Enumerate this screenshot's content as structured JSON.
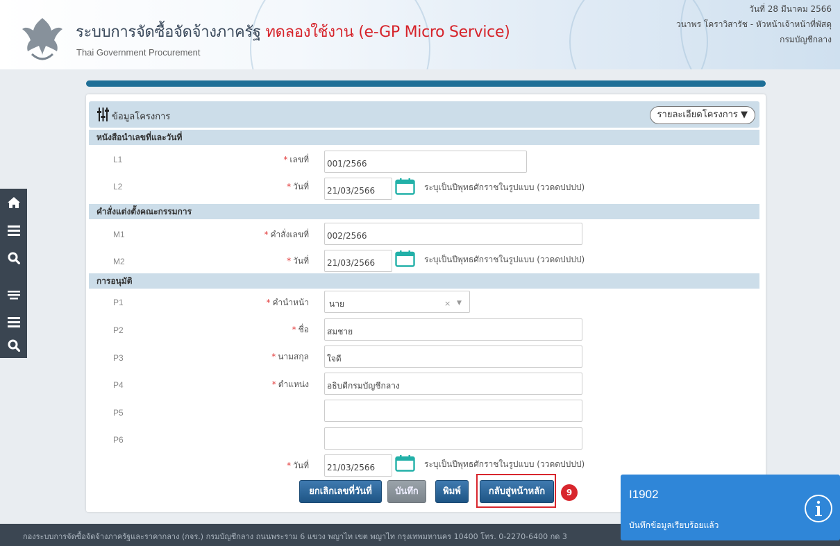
{
  "header": {
    "title_main": "ระบบการจัดซื้อจัดจ้างภาครัฐ",
    "title_trial": "ทดลองใช้งาน (e-GP Micro Service)",
    "subtitle": "Thai Government Procurement",
    "date": "วันที่ 28 มีนาคม 2566",
    "user": "วนาพร โคราวิสารัช - หัวหน้าเจ้าหน้าที่พัสดุ",
    "department": "กรมบัญชีกลาง"
  },
  "sidebar": {
    "icons": [
      "home-icon",
      "menu-icon",
      "search-icon",
      "list-icon",
      "menu-icon",
      "search-icon"
    ]
  },
  "project": {
    "title": "ข้อมูลโครงการ",
    "detail_button": "รายละเอียดโครงการ ▼"
  },
  "sections": {
    "letter": {
      "title": "หนังสือนำเลขที่และวันที่",
      "l1": {
        "code": "L1",
        "label": "เลขที่",
        "value": "001/2566"
      },
      "l2": {
        "code": "L2",
        "label": "วันที่",
        "value": "21/03/2566",
        "hint": "ระบุเป็นปีพุทธศักราชในรูปแบบ (ววดดปปปป)"
      }
    },
    "committee": {
      "title": "คำสั่งแต่งตั้งคณะกรรมการ",
      "m1": {
        "code": "M1",
        "label": "คำสั่งเลขที่",
        "value": "002/2566"
      },
      "m2": {
        "code": "M2",
        "label": "วันที่",
        "value": "21/03/2566",
        "hint": "ระบุเป็นปีพุทธศักราชในรูปแบบ (ววดดปปปป)"
      }
    },
    "approval": {
      "title": "การอนุมัติ",
      "p1": {
        "code": "P1",
        "label": "คำนำหน้า",
        "value": "นาย",
        "clear": "×",
        "arrow": "▼"
      },
      "p2": {
        "code": "P2",
        "label": "ชื่อ",
        "value": "สมชาย"
      },
      "p3": {
        "code": "P3",
        "label": "นามสกุล",
        "value": "ใจดี"
      },
      "p4": {
        "code": "P4",
        "label": "ตำแหน่ง",
        "value": "อธิบดีกรมบัญชีกลาง"
      },
      "p5": {
        "code": "P5",
        "value": ""
      },
      "p6": {
        "code": "P6",
        "value": ""
      },
      "date": {
        "label": "วันที่",
        "value": "21/03/2566",
        "hint": "ระบุเป็นปีพุทธศักราชในรูปแบบ (ววดดปปปป)"
      }
    }
  },
  "required_mark": "*",
  "actions": {
    "cancel_number": "ยกเลิกเลขที่วันที่",
    "save": "บันทึก",
    "print": "พิมพ์",
    "back_home": "กลับสู่หน้าหลัก",
    "step": "9"
  },
  "footer": {
    "text": "กองระบบการจัดซื้อจัดจ้างภาครัฐและราคากลาง (กจร.) กรมบัญชีกลาง ถนนพระราม 6 แขวง พญาไท เขต พญาไท กรุงเทพมหานคร 10400 โทร. 0-2270-6400 กด 3"
  },
  "toast": {
    "code": "I1902",
    "message": "บันทึกข้อมูลเรียบร้อยแล้ว",
    "icon": "info-icon"
  },
  "colors": {
    "brand_blue": "#1f6f97",
    "section_bg": "#ccdde9",
    "toast_bg": "#2f86d8",
    "required": "#e23b3b",
    "highlight": "#d8262d"
  }
}
